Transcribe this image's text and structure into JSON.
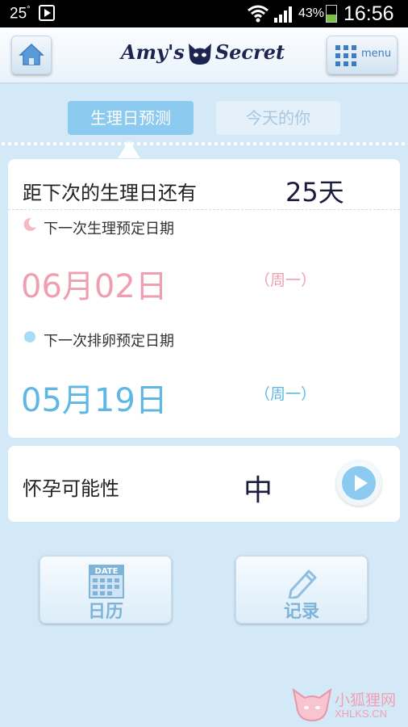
{
  "status_bar": {
    "temperature": "25",
    "temp_unit": "°",
    "battery": "43%",
    "time": "16:56"
  },
  "app_bar": {
    "logo_text_left": "Amy's",
    "logo_text_right": "Secret",
    "menu_label": "menu"
  },
  "tabs": [
    {
      "label": "生理日预测",
      "active": true
    },
    {
      "label": "今天的你",
      "active": false
    }
  ],
  "forecast": {
    "until_label": "距下次的生理日还有",
    "until_value": "25天",
    "next_period_label": "下一次生理预定日期",
    "next_period_date": "06月02日",
    "next_period_weekday": "（周一）",
    "next_ovulation_label": "下一次排卵预定日期",
    "next_ovulation_date": "05月19日",
    "next_ovulation_weekday": "（周一）"
  },
  "pregnancy": {
    "label": "怀孕可能性",
    "value": "中"
  },
  "actions": {
    "calendar_icon_text": "DATE",
    "calendar_label": "日历",
    "record_label": "记录"
  },
  "watermark": {
    "title": "小狐狸网",
    "domain": "XHLKS.CN"
  },
  "colors": {
    "accent_blue": "#8ccaf0",
    "period_pink": "#ee9fb1",
    "ovulation_blue": "#5fb8e4",
    "background": "#d3e9f8"
  }
}
